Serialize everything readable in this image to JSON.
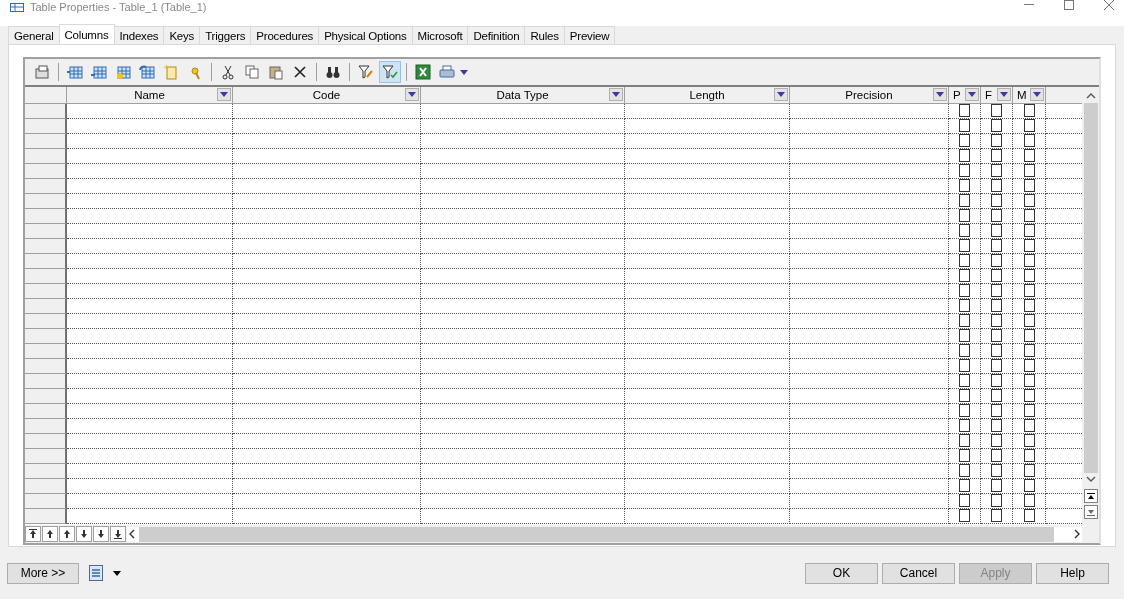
{
  "window": {
    "title": "Table Properties - Table_1 (Table_1)"
  },
  "tabs": [
    {
      "label": "General",
      "selected": false
    },
    {
      "label": "Columns",
      "selected": true
    },
    {
      "label": "Indexes",
      "selected": false
    },
    {
      "label": "Keys",
      "selected": false
    },
    {
      "label": "Triggers",
      "selected": false
    },
    {
      "label": "Procedures",
      "selected": false
    },
    {
      "label": "Physical Options",
      "selected": false
    },
    {
      "label": "Microsoft",
      "selected": false
    },
    {
      "label": "Definition",
      "selected": false
    },
    {
      "label": "Rules",
      "selected": false
    },
    {
      "label": "Preview",
      "selected": false
    }
  ],
  "toolbar": [
    {
      "kind": "properties",
      "on": false
    },
    {
      "kind": "sep"
    },
    {
      "kind": "add-row",
      "on": false
    },
    {
      "kind": "insert-row",
      "on": false
    },
    {
      "kind": "add-columns",
      "on": false
    },
    {
      "kind": "replace-columns",
      "on": false
    },
    {
      "kind": "new-doc",
      "on": false
    },
    {
      "kind": "new-key",
      "on": false
    },
    {
      "kind": "sep"
    },
    {
      "kind": "cut",
      "on": false
    },
    {
      "kind": "copy",
      "on": false
    },
    {
      "kind": "paste",
      "on": false
    },
    {
      "kind": "delete",
      "on": false
    },
    {
      "kind": "sep"
    },
    {
      "kind": "find",
      "on": false
    },
    {
      "kind": "sep"
    },
    {
      "kind": "filter-edit",
      "on": false
    },
    {
      "kind": "filter",
      "on": true
    },
    {
      "kind": "sep"
    },
    {
      "kind": "excel",
      "on": false
    },
    {
      "kind": "print",
      "on": false
    }
  ],
  "columns": [
    {
      "label": "Name",
      "kind": "text"
    },
    {
      "label": "Code",
      "kind": "text"
    },
    {
      "label": "Data Type",
      "kind": "text"
    },
    {
      "label": "Length",
      "kind": "text"
    },
    {
      "label": "Precision",
      "kind": "text"
    },
    {
      "label": "P",
      "kind": "check"
    },
    {
      "label": "F",
      "kind": "check"
    },
    {
      "label": "M",
      "kind": "check"
    }
  ],
  "rows": [
    {
      "checks": [
        false,
        false,
        false
      ]
    },
    {
      "checks": [
        false,
        false,
        false
      ]
    },
    {
      "checks": [
        false,
        false,
        false
      ]
    },
    {
      "checks": [
        false,
        false,
        false
      ]
    },
    {
      "checks": [
        false,
        false,
        false
      ]
    },
    {
      "checks": [
        false,
        false,
        false
      ]
    },
    {
      "checks": [
        false,
        false,
        false
      ]
    },
    {
      "checks": [
        false,
        false,
        false
      ]
    },
    {
      "checks": [
        false,
        false,
        false
      ]
    },
    {
      "checks": [
        false,
        false,
        false
      ]
    },
    {
      "checks": [
        false,
        false,
        false
      ]
    },
    {
      "checks": [
        false,
        false,
        false
      ]
    },
    {
      "checks": [
        false,
        false,
        false
      ]
    },
    {
      "checks": [
        false,
        false,
        false
      ]
    },
    {
      "checks": [
        false,
        false,
        false
      ]
    },
    {
      "checks": [
        false,
        false,
        false
      ]
    },
    {
      "checks": [
        false,
        false,
        false
      ]
    },
    {
      "checks": [
        false,
        false,
        false
      ]
    },
    {
      "checks": [
        false,
        false,
        false
      ]
    },
    {
      "checks": [
        false,
        false,
        false
      ]
    },
    {
      "checks": [
        false,
        false,
        false
      ]
    },
    {
      "checks": [
        false,
        false,
        false
      ]
    },
    {
      "checks": [
        false,
        false,
        false
      ]
    },
    {
      "checks": [
        false,
        false,
        false
      ]
    },
    {
      "checks": [
        false,
        false,
        false
      ]
    },
    {
      "checks": [
        false,
        false,
        false
      ]
    },
    {
      "checks": [
        false,
        false,
        false
      ]
    },
    {
      "checks": [
        false,
        false,
        false
      ]
    }
  ],
  "buttons": [
    {
      "label": "OK",
      "disabled": false
    },
    {
      "label": "Cancel",
      "disabled": false
    },
    {
      "label": "Apply",
      "disabled": true
    },
    {
      "label": "Help",
      "disabled": false
    }
  ],
  "more_button": {
    "label": "More >>"
  }
}
